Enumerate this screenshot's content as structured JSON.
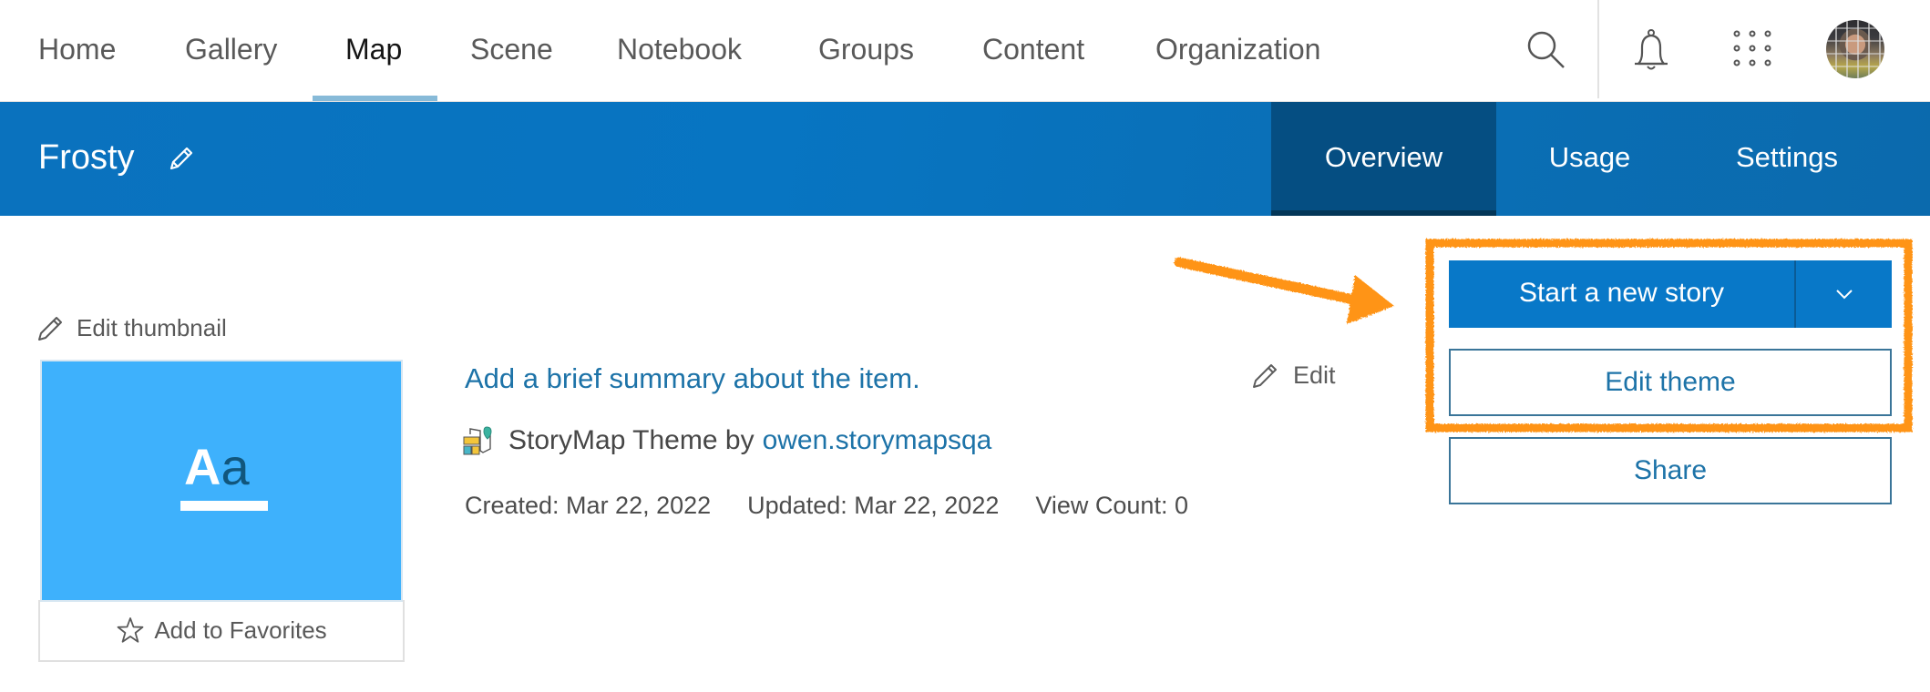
{
  "topnav": {
    "items": [
      {
        "label": "Home"
      },
      {
        "label": "Gallery"
      },
      {
        "label": "Map",
        "active": true
      },
      {
        "label": "Scene"
      },
      {
        "label": "Notebook"
      },
      {
        "label": "Groups"
      },
      {
        "label": "Content"
      },
      {
        "label": "Organization"
      }
    ],
    "icons": {
      "search": "search-icon",
      "notifications": "bell-icon",
      "apps": "app-launcher-grid-icon",
      "user": "user-avatar"
    }
  },
  "header": {
    "title": "Frosty",
    "title_edit_icon": "pencil-icon",
    "tabs": [
      {
        "label": "Overview",
        "active": true
      },
      {
        "label": "Usage"
      },
      {
        "label": "Settings"
      }
    ]
  },
  "thumbnail": {
    "edit_label": "Edit thumbnail",
    "preview_big": "A",
    "preview_small": "a",
    "favorites_label": "Add to Favorites"
  },
  "details": {
    "summary_placeholder": "Add a brief summary about the item.",
    "edit_label": "Edit",
    "item_type": "StoryMap Theme",
    "by_label": "by",
    "owner": "owen.storymapsqa",
    "created": "Created: Mar 22, 2022",
    "updated": "Updated: Mar 22, 2022",
    "view_count": "View Count: 0"
  },
  "actions": {
    "primary": "Start a new story",
    "edit_theme": "Edit theme",
    "share": "Share"
  },
  "colors": {
    "brand_blue": "#0878c8",
    "header_blue": "#0775c2",
    "active_tab": "#054e82",
    "link": "#1d73a8",
    "thumbnail_bg": "#3eb1fc",
    "annotation_orange": "#ff9414"
  }
}
